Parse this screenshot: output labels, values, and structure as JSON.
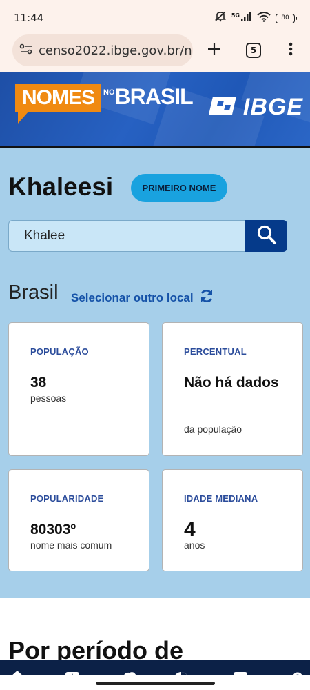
{
  "status_bar": {
    "time": "11:44",
    "network": "5G",
    "battery": "80",
    "icons": [
      "mute-icon",
      "signal-icon",
      "wifi-icon",
      "battery-icon"
    ]
  },
  "browser": {
    "url": "censo2022.ibge.gov.br/n",
    "tab_count": "5",
    "icons": [
      "site-info-icon",
      "new-tab-icon",
      "tabs-icon",
      "more-menu-icon"
    ]
  },
  "banner": {
    "logo_nomes": "NOMES",
    "logo_no": "NO",
    "logo_brasil": "BRASIL",
    "logo_ibge": "IBGE",
    "colors": {
      "banner_blue": "#2761c2",
      "logo_orange": "#f08a12"
    }
  },
  "main": {
    "name": "Khaleesi",
    "badge": "PRIMEIRO NOME",
    "search": {
      "value": "Khalee",
      "placeholder": ""
    },
    "place": "Brasil",
    "change_location": "Selecionar outro local",
    "cards": [
      {
        "label": "POPULAÇÃO",
        "value": "38",
        "unit": "pessoas"
      },
      {
        "label": "PERCENTUAL",
        "value": "Não há dados",
        "unit": "da população"
      },
      {
        "label": "POPULARIDADE",
        "value": "80303º",
        "unit": "nome mais comum"
      },
      {
        "label": "IDADE MEDIANA",
        "value": "4",
        "unit": "anos"
      }
    ],
    "colors": {
      "section_bg": "#a6cfea",
      "badge_bg": "#19a2df",
      "search_btn": "#053a8a",
      "label_blue": "#2b4c9b"
    }
  },
  "bottom": {
    "heading": "Por período de"
  },
  "nav": {
    "icons": [
      "home-icon",
      "star-icon",
      "cloud-icon",
      "chart-icon",
      "book-icon",
      "search-icon"
    ]
  }
}
